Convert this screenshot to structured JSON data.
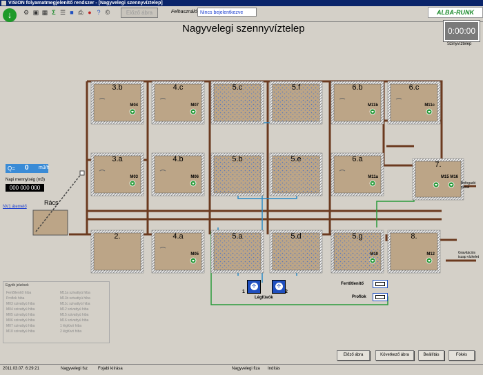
{
  "window": {
    "title": "VISION folyamatmegjelenítő rendszer - [Nagyvelegi szennyvíztelep]"
  },
  "toolbar": {
    "prev_button": "Előző ábra",
    "user_label": "Felhasználó:",
    "user_value": "Nincs bejelentkezve",
    "logo_text": "ALBA-RUNK",
    "icons": [
      "tool-icon",
      "folder-icon",
      "grid-icon",
      "sigma-icon",
      "list-icon",
      "save-icon",
      "print-icon",
      "stop-icon",
      "help-icon",
      "copyright-icon"
    ]
  },
  "page": {
    "title": "Nagyvelegi szennyvíztelep"
  },
  "timer": {
    "value": "0:00:00",
    "label": "Szinyvíztelep"
  },
  "flow": {
    "q_label": "Q=",
    "value": "0",
    "unit": "m3/h"
  },
  "daily": {
    "label": "Napi mennyiség (m3)",
    "value": "000 000 000"
  },
  "inlet": {
    "nv1_label": "NV1 átemelő",
    "racs_label": "Rács"
  },
  "basins": [
    {
      "label": "3.b",
      "motor": "M04"
    },
    {
      "label": "4.c",
      "motor": "M07"
    },
    {
      "label": "5.c",
      "motor": ""
    },
    {
      "label": "5.f",
      "motor": ""
    },
    {
      "label": "6.b",
      "motor": "M11b"
    },
    {
      "label": "6.c",
      "motor": "M11c"
    },
    {
      "label": "3.a",
      "motor": "M03"
    },
    {
      "label": "4.b",
      "motor": "M06"
    },
    {
      "label": "5.b",
      "motor": ""
    },
    {
      "label": "5.e",
      "motor": ""
    },
    {
      "label": "6.a",
      "motor": "M11a"
    },
    {
      "label": "7.",
      "motor": "M15  M16"
    },
    {
      "label": "2.",
      "motor": ""
    },
    {
      "label": "4.a",
      "motor": "M05"
    },
    {
      "label": "5.a",
      "motor": ""
    },
    {
      "label": "5.d",
      "motor": ""
    },
    {
      "label": "5.g",
      "motor": "M10"
    },
    {
      "label": "8.",
      "motor": "M12"
    }
  ],
  "side_labels": {
    "b7": "Befogadó patak",
    "b8": "Gravitációs iszap vízkelet"
  },
  "blowers": {
    "label": "Légfúvók",
    "n1": "1",
    "n2": "2"
  },
  "units": {
    "fertotlenito": "Fertőtlenítő",
    "proflok": "Proflok"
  },
  "legend": {
    "title": "Egyéb jelzések",
    "col1": [
      "Fertőtlenítő hiba",
      "Proflok hiba",
      "M03 szivattyú hiba",
      "M04 szivattyú hiba",
      "M05 szivattyú hiba",
      "M06 szivattyú hiba",
      "M07 szivattyú hiba",
      "M10 szivattyú hiba"
    ],
    "col2": [
      "M11a szivattyú hiba",
      "M11b szivattyú hiba",
      "M11c szivattyú hiba",
      "M12 szivattyú hiba",
      "M15 szivattyú hiba",
      "M16 szivattyú hiba",
      "1 légfúvó hiba",
      "2 légfúvó hiba"
    ]
  },
  "bottom_buttons": {
    "prev": "Előző ábra",
    "next": "Következő ábra",
    "settings": "Beállítás",
    "close": "Fókés"
  },
  "status": {
    "datetime": "2011.03.07. 6:29:21",
    "page": "Nagyvelegi fsz",
    "msg": "Fojabi kiírása",
    "site": "Nagyvelegi fiza",
    "state": "Indítás"
  }
}
